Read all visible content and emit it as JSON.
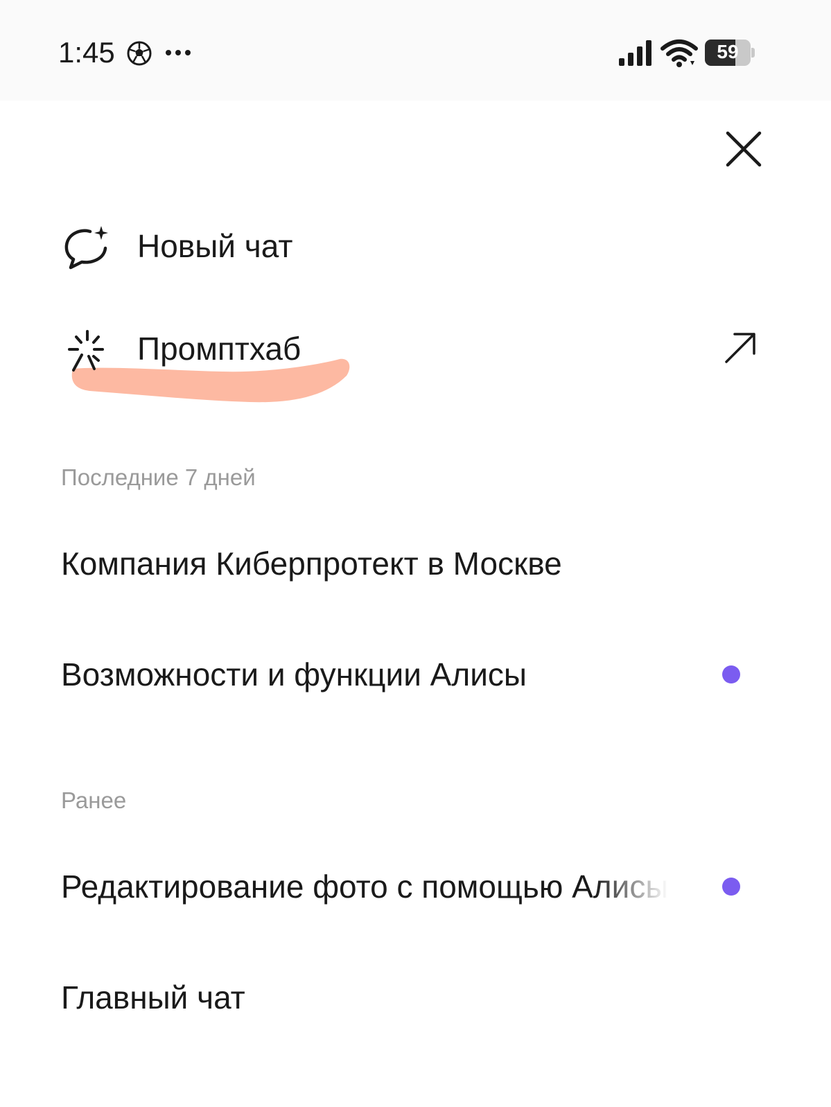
{
  "status_bar": {
    "time": "1:45",
    "battery": "59",
    "icons": [
      "soccer-ball-icon",
      "more-dots-icon",
      "signal-icon",
      "wifi-icon",
      "battery-icon"
    ]
  },
  "menu": {
    "new_chat_label": "Новый чат",
    "new_chat_icon": "chat-sparkle-icon",
    "prompthub_label": "Промптхаб",
    "prompthub_icon": "magic-sparkle-icon",
    "external_icon": "arrow-up-right-icon",
    "close_icon": "close-icon"
  },
  "sections": [
    {
      "header": "Последние 7 дней",
      "chats": [
        {
          "title": "Компания Киберпротект в Москве",
          "unread": false
        },
        {
          "title": "Возможности и функции Алисы",
          "unread": true
        }
      ]
    },
    {
      "header": "Ранее",
      "chats": [
        {
          "title": "Редактирование фото с помощью Алисы",
          "unread": true
        },
        {
          "title": "Главный чат",
          "unread": false
        }
      ]
    }
  ],
  "colors": {
    "unread_dot": "#7b5cf0",
    "highlight": "#fdb9a2",
    "section_header": "#9a9a9a",
    "text": "#1a1a1a"
  }
}
